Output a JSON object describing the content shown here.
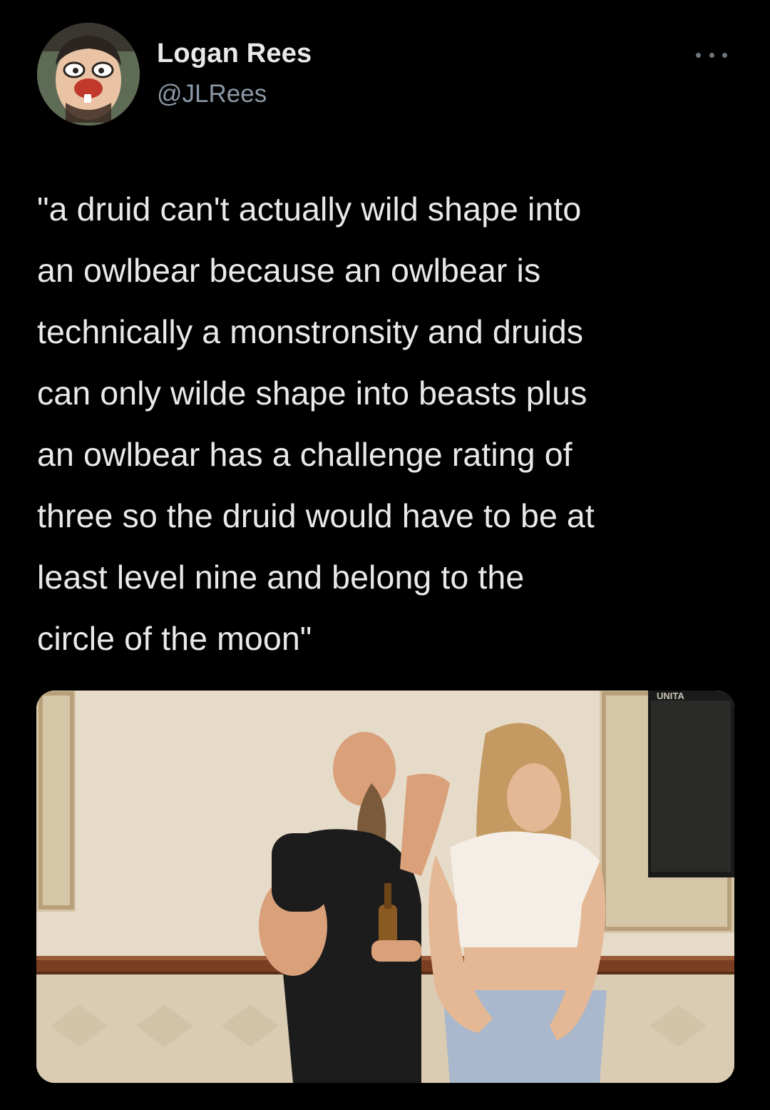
{
  "author": {
    "name": "Logan Rees",
    "handle": "@JLRees",
    "avatar_icon": "avatar-cartoon-face-icon"
  },
  "menu": {
    "icon": "more-options-icon"
  },
  "tweet": {
    "text": "\"a druid can't actually wild shape into\nan owlbear because an owlbear is\ntechnically a monstronsity and druids\ncan only wilde shape into beasts plus\nan owlbear has a challenge rating of\nthree so the druid would have to be at\nleast level nine and belong to the\ncircle of the moon\""
  },
  "media": {
    "sign_text": "UNITA",
    "colors": {
      "wall": "#e6dbc9",
      "wainscot": "#d9c9b0",
      "rail": "#7a3f22",
      "shirt": "#1c1c1c",
      "skin": "#d9a07a",
      "hair": "#c49a62"
    }
  },
  "theme": {
    "background": "#000000",
    "text": "#e7e9ea",
    "secondary": "#8b98a5"
  }
}
